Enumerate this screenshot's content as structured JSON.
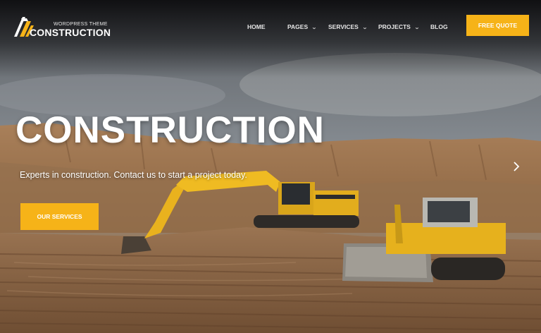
{
  "header": {
    "logo": {
      "tagline": "WORDPRESS THEME",
      "name": "CONSTRUCTION"
    },
    "nav": [
      {
        "label": "HOME",
        "has_dropdown": false
      },
      {
        "label": "PAGES",
        "has_dropdown": true
      },
      {
        "label": "SERVICES",
        "has_dropdown": true
      },
      {
        "label": "PROJECTS",
        "has_dropdown": true
      },
      {
        "label": "BLOG",
        "has_dropdown": false
      }
    ],
    "cta_label": "FREE QUOTE"
  },
  "hero": {
    "title": "CONSTRUCTION",
    "subtitle": "Experts in construction. Contact us to start a project today.",
    "button_label": "OUR SERVICES",
    "next_icon": "chevron-right-icon"
  },
  "colors": {
    "accent": "#f6b318",
    "nav_text": "#e6e6e6",
    "heading": "#ffffff"
  }
}
